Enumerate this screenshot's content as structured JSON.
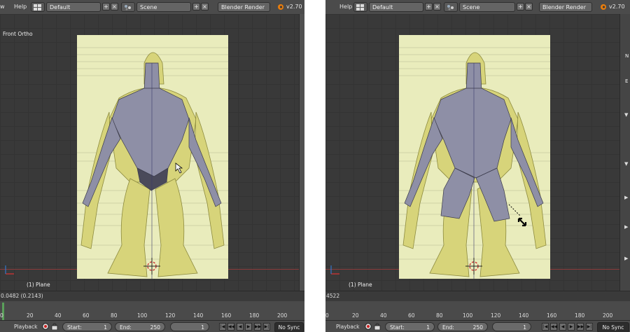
{
  "left": {
    "menu_fragment": "w",
    "help": "Help",
    "layout": "Default",
    "scene": "Scene",
    "engine": "Blender Render",
    "version": "v2.70",
    "view_label": "Front Ortho",
    "object_label": "(1) Plane",
    "status_value": "0.0482 (0.2143)",
    "playback": "Playback",
    "start_label": "Start:",
    "start_value": "1",
    "end_label": "End:",
    "end_value": "250",
    "frame_value": "1",
    "sync": "No Sync",
    "ticks": [
      "0",
      "20",
      "40",
      "60",
      "80",
      "100",
      "120",
      "140",
      "160",
      "180",
      "200"
    ]
  },
  "right": {
    "help": "Help",
    "layout": "Default",
    "scene": "Scene",
    "engine": "Blender Render",
    "version": "v2.70",
    "object_label": "(1) Plane",
    "status_value": "4522",
    "playback": "Playback",
    "start_label": "Start:",
    "start_value": "1",
    "end_label": "End:",
    "end_value": "250",
    "frame_value": "1",
    "sync": "No Sync",
    "side_labels": [
      "N",
      "E"
    ],
    "ticks": [
      "0",
      "20",
      "40",
      "60",
      "80",
      "100",
      "120",
      "140",
      "160",
      "180",
      "200"
    ]
  },
  "colors": {
    "viewport_bg": "#393939",
    "reference_image": "#e9ecbc",
    "creature_fill": "#d7d47a",
    "mesh_fill": "#8e8fa6",
    "mesh_edge": "#3a3a4a",
    "header_bg": "#4b4b4b"
  }
}
